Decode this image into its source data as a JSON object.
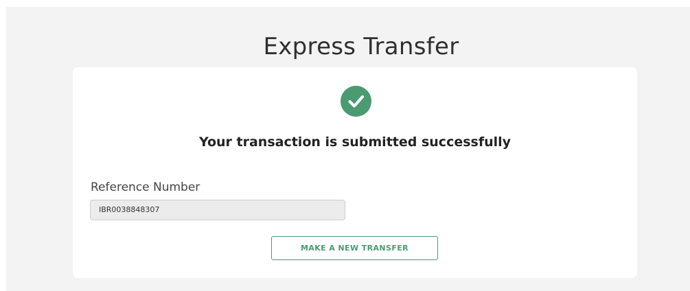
{
  "page": {
    "title": "Express Transfer"
  },
  "confirmation": {
    "icon": "check-circle-icon",
    "message": "Your transaction is submitted successfully",
    "reference_label": "Reference Number",
    "reference_value": "IBR0038848307",
    "new_transfer_label": "MAKE A NEW TRANSFER"
  },
  "colors": {
    "accent": "#4a9a72",
    "background": "#f3f3f3",
    "card": "#ffffff"
  }
}
